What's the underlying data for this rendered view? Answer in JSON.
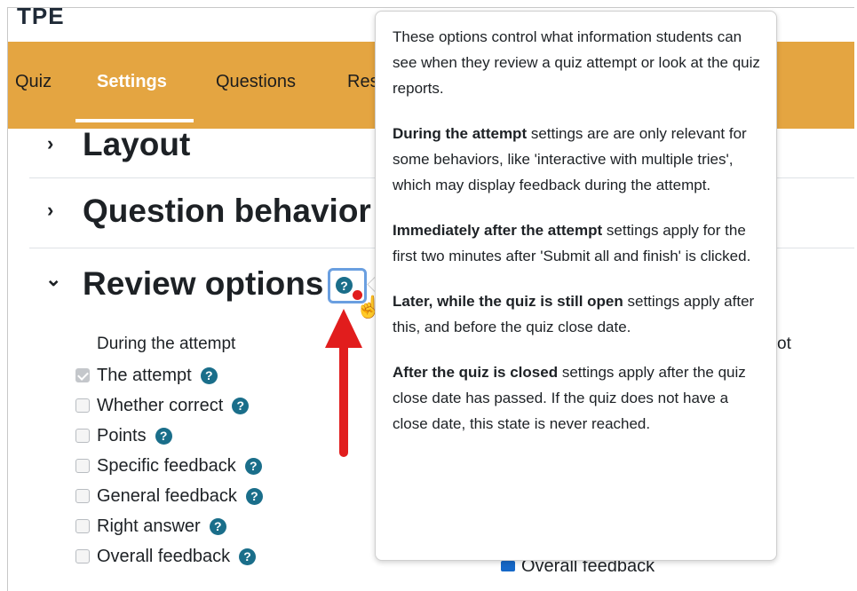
{
  "header": {
    "logo_partial": "TPE"
  },
  "tabs": [
    {
      "label": "Quiz",
      "active": false
    },
    {
      "label": "Settings",
      "active": true
    },
    {
      "label": "Questions",
      "active": false
    },
    {
      "label": "Res",
      "active": false
    }
  ],
  "sections": [
    {
      "label": "Layout",
      "state": "collapsed"
    },
    {
      "label": "Question behavior",
      "state": "collapsed"
    },
    {
      "label": "Review options",
      "state": "expanded"
    }
  ],
  "review": {
    "col_during": "During the attempt",
    "col_right_partial": "ot",
    "options": [
      {
        "label": "The attempt",
        "checked": true,
        "disabled": true
      },
      {
        "label": "Whether correct",
        "checked": false
      },
      {
        "label": "Points",
        "checked": false
      },
      {
        "label": "Specific feedback",
        "checked": false
      },
      {
        "label": "General feedback",
        "checked": false
      },
      {
        "label": "Right answer",
        "checked": false
      },
      {
        "label": "Overall feedback",
        "checked": false
      }
    ],
    "bottom_partial": "Overall feedback"
  },
  "icons": {
    "help": "?",
    "chevron_right": "›",
    "chevron_down": "⌄",
    "cursor": "☝"
  },
  "popover": {
    "p1": "These options control what information students can see when they review a quiz attempt or look at the quiz reports.",
    "p2_bold": "During the attempt",
    "p2_rest": " settings are are only relevant for some behaviors, like 'interactive with multiple tries', which may display feedback during the attempt.",
    "p3_bold": "Immediately after the attempt",
    "p3_rest": " settings apply for the first two minutes after 'Submit all and finish' is clicked.",
    "p4_bold": "Later, while the quiz is still open",
    "p4_rest": " settings apply after this, and before the quiz close date.",
    "p5_bold": "After the quiz is closed",
    "p5_rest": " settings apply after the quiz close date has passed. If the quiz does not have a close date, this state is never reached."
  },
  "colors": {
    "nav": "#e4a541",
    "help": "#1a6e8a",
    "annotation": "#e11d1d",
    "highlight": "#6a9fe0"
  }
}
